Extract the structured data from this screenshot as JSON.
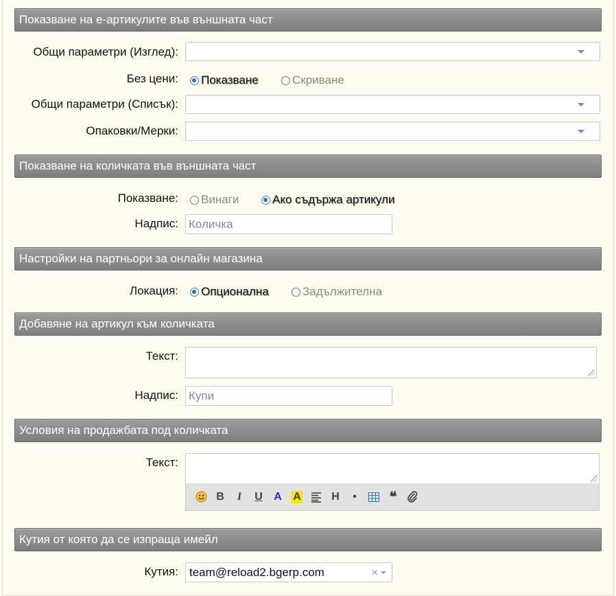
{
  "sections": {
    "eitems": "Показване на е-артикулите във външната част",
    "cart": "Показване на количката във външната част",
    "partners": "Настройки на партньори за онлайн магазина",
    "addtocart": "Добавяне на артикул към количката",
    "terms": "Условия на продажбата под количката",
    "mailbox": "Кутия от която да се изпраща имейл"
  },
  "fields": {
    "general_view_label": "Общи параметри (Изглед):",
    "no_prices_label": "Без цени:",
    "no_prices_options": [
      "Показване",
      "Скриване"
    ],
    "no_prices_selected": "Показване",
    "general_list_label": "Общи параметри (Списък):",
    "packaging_label": "Опаковки/Мерки:",
    "cart_show_label": "Показване:",
    "cart_show_options": [
      "Винаги",
      "Ако съдържа артикули"
    ],
    "cart_show_selected": "Ако съдържа артикули",
    "cart_caption_label": "Надпис:",
    "cart_caption_placeholder": "Количка",
    "location_label": "Локация:",
    "location_options": [
      "Опционална",
      "Задължителна"
    ],
    "location_selected": "Опционална",
    "add_text_label": "Текст:",
    "add_caption_label": "Надпис:",
    "add_caption_placeholder": "Купи",
    "terms_text_label": "Текст:",
    "mailbox_label": "Кутия:",
    "mailbox_value": "team@reload2.bgerp.com",
    "mailbox_clear": "×"
  },
  "toolbar": {
    "bold": "B",
    "italic": "I",
    "underline": "U",
    "color": "A",
    "highlight": "A",
    "heading": "H",
    "bullet": "•",
    "quote": "❝"
  },
  "colors": {
    "section_bg": "#8a8a8a",
    "radio_selected": "#2a6fd0",
    "highlight": "#f5e400",
    "text_color": "#2233cc"
  }
}
